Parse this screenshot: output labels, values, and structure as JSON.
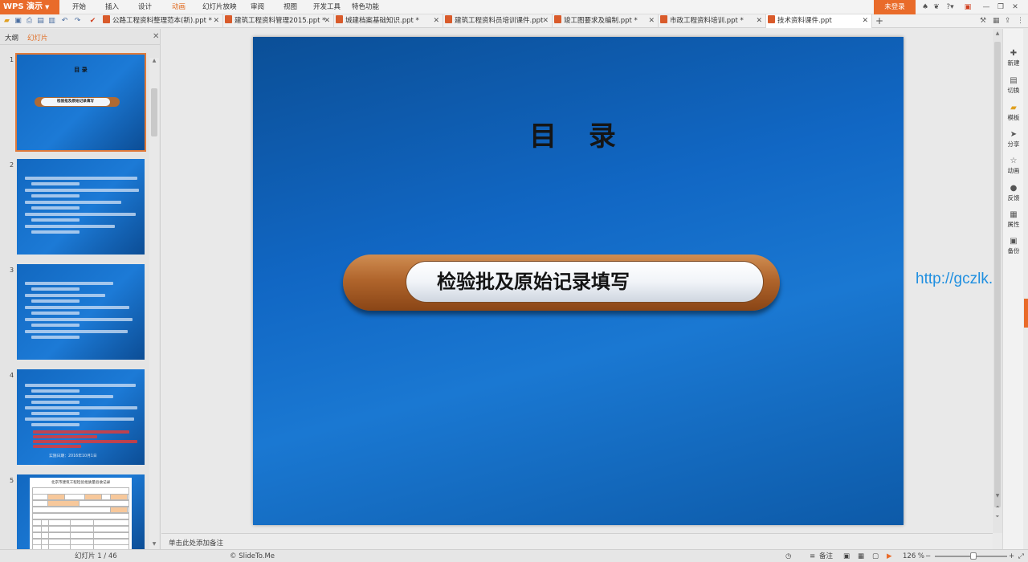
{
  "app": {
    "name": "WPS 演示"
  },
  "menu": {
    "items": [
      "开始",
      "插入",
      "设计",
      "动画",
      "幻灯片放映",
      "审阅",
      "视图",
      "开发工具",
      "特色功能"
    ],
    "active": "动画",
    "login": "未登录"
  },
  "tabs": [
    {
      "label": "公路工程资料整理范本(新).ppt *"
    },
    {
      "label": "建筑工程资料管理2015.ppt *"
    },
    {
      "label": "城建档案基础知识.ppt *"
    },
    {
      "label": "建筑工程资料员培训课件.ppt"
    },
    {
      "label": "竣工图要求及编制.ppt *"
    },
    {
      "label": "市政工程资料培训.ppt *"
    },
    {
      "label": "技术资料课件.ppt"
    }
  ],
  "left_panel": {
    "tabs": [
      "大纲",
      "幻灯片"
    ],
    "active_tab": "幻灯片",
    "slides": [
      {
        "number": "1",
        "title": "目 录",
        "pill": "检验批及原始记录填写"
      },
      {
        "number": "2"
      },
      {
        "number": "3"
      },
      {
        "number": "4",
        "footer": "实施日期：2016年10月1日"
      },
      {
        "number": "5",
        "table_title": "北京市建筑工程检验批质量验收记录"
      }
    ]
  },
  "slide": {
    "title": "目 录",
    "pill_text": "检验批及原始记录填写"
  },
  "watermark": "http://gczlk.cn",
  "notes_placeholder": "单击此处添加备注",
  "right_sidebar": [
    "新建",
    "切换",
    "模板",
    "分享",
    "动画",
    "反馈",
    "属性",
    "备份"
  ],
  "status": {
    "slide_counter": "幻灯片 1 / 46",
    "theme": "© SlideTo.Me",
    "notes_button": "备注",
    "zoom": "126 %"
  },
  "colors": {
    "accent": "#e96b2a",
    "slide_blue": "#1a78d2",
    "pill_bronze": "#b0652c",
    "watermark": "#1f8fe0"
  }
}
